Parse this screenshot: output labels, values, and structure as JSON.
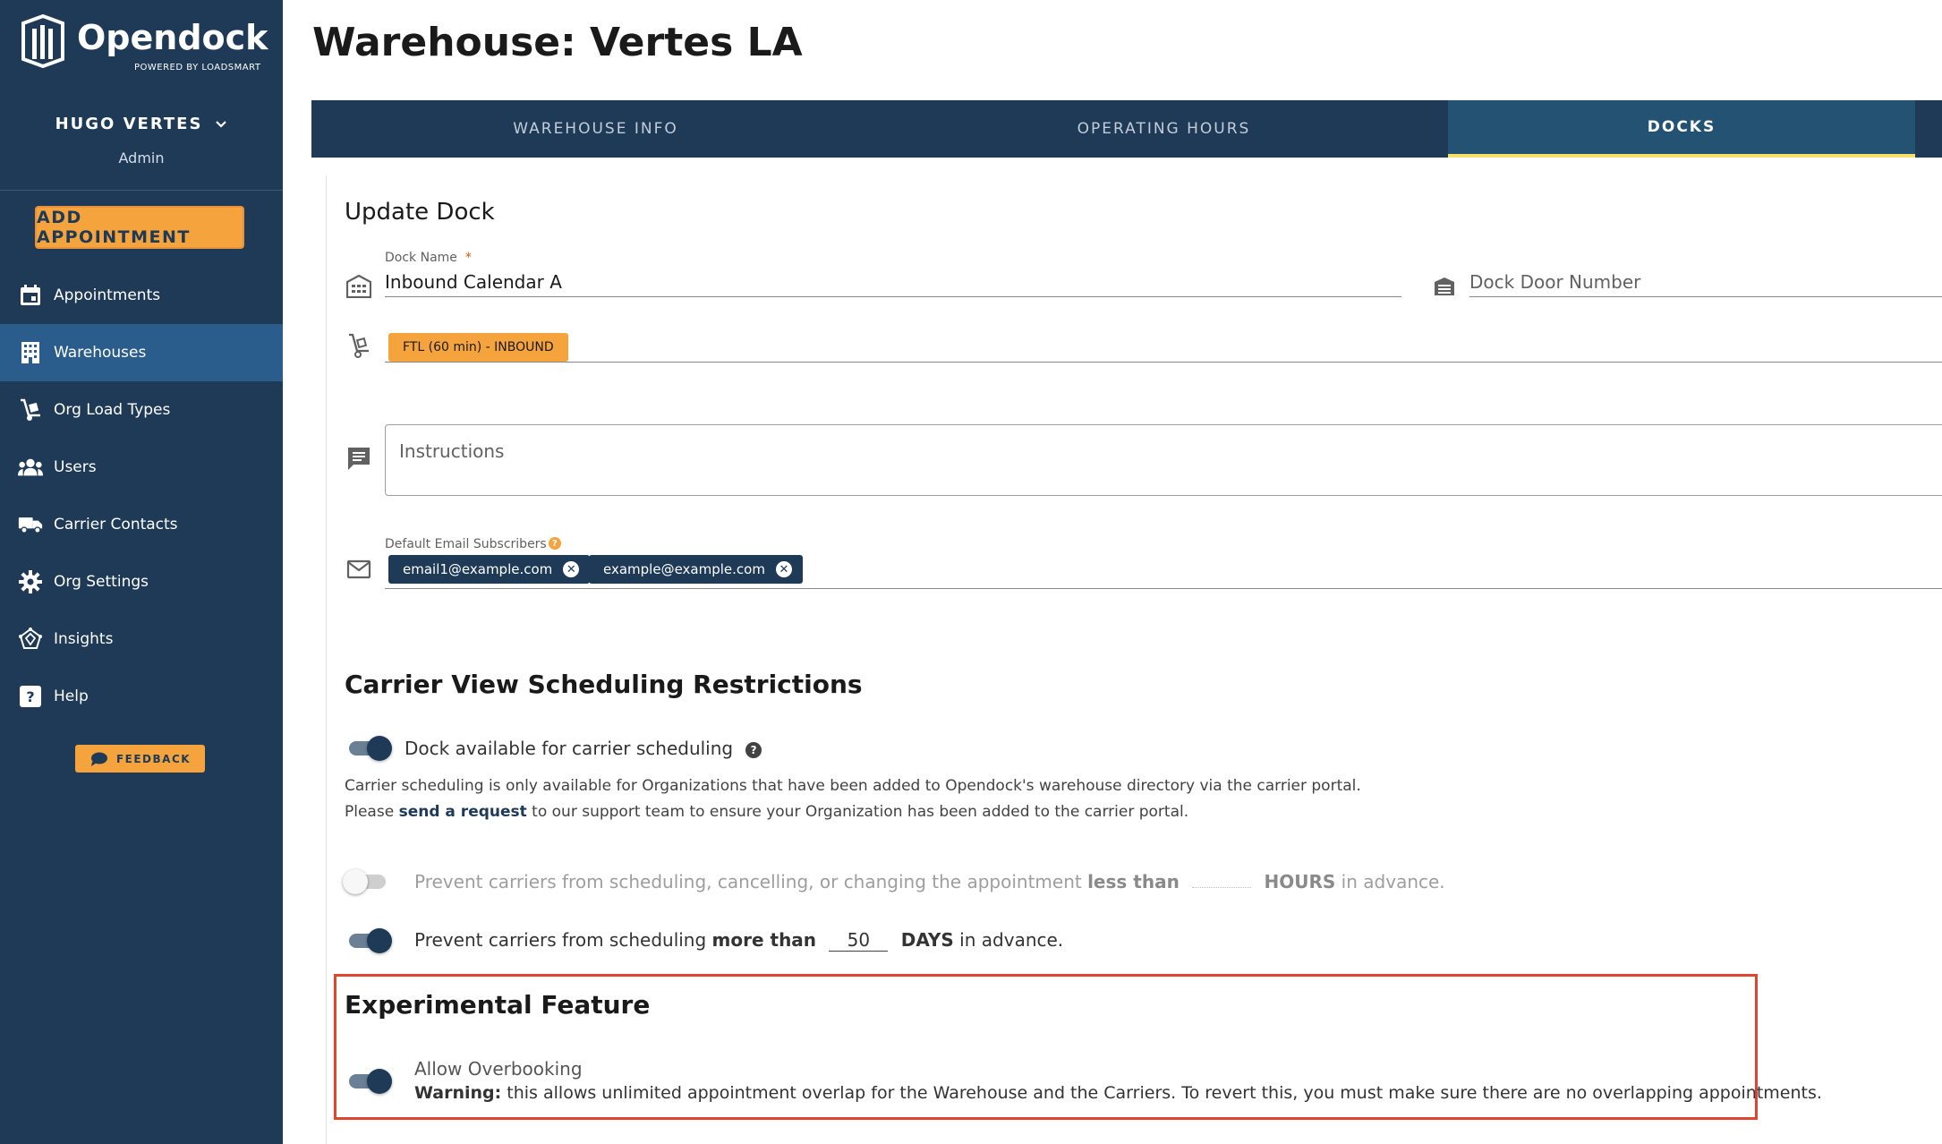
{
  "app": {
    "brand_name": "Opendock",
    "brand_sub": "POWERED BY LOADSMART",
    "user_name": "HUGO VERTES",
    "user_role": "Admin",
    "add_appointment": "ADD APPOINTMENT",
    "feedback": "FEEDBACK"
  },
  "nav": {
    "items": [
      {
        "label": "Appointments",
        "icon": "calendar-icon"
      },
      {
        "label": "Warehouses",
        "icon": "building-icon"
      },
      {
        "label": "Org Load Types",
        "icon": "hand-truck-icon"
      },
      {
        "label": "Users",
        "icon": "users-icon"
      },
      {
        "label": "Carrier Contacts",
        "icon": "truck-icon"
      },
      {
        "label": "Org Settings",
        "icon": "gear-icon"
      },
      {
        "label": "Insights",
        "icon": "insights-icon"
      },
      {
        "label": "Help",
        "icon": "help-icon"
      }
    ],
    "active": "Warehouses"
  },
  "page": {
    "title": "Warehouse: Vertes LA",
    "tabs": [
      {
        "label": "WAREHOUSE INFO"
      },
      {
        "label": "OPERATING HOURS"
      },
      {
        "label": "DOCKS"
      }
    ],
    "active_tab": "DOCKS"
  },
  "form": {
    "title": "Update Dock",
    "dock_name_label": "Dock Name",
    "dock_name_required": "*",
    "dock_name_value": "Inbound Calendar A",
    "dock_door_placeholder": "Dock Door Number",
    "load_type_chip": "FTL (60 min) - INBOUND",
    "instructions_label": "Instructions",
    "subscribers_label": "Default Email Subscribers",
    "subscribers": [
      "email1@example.com",
      "example@example.com"
    ]
  },
  "restrictions": {
    "title": "Carrier View Scheduling Restrictions",
    "dock_available_label": "Dock available for carrier scheduling",
    "dock_available_on": true,
    "desc_line1": "Carrier scheduling is only available for Organizations that have been added to Opendock's warehouse directory via the carrier portal.",
    "desc_line2_pre": "Please ",
    "desc_line2_link": "send a request",
    "desc_line2_post": " to our support team to ensure your Organization has been added to the carrier portal.",
    "prevent_less": {
      "pre": "Prevent carriers from scheduling, cancelling, or changing the appointment ",
      "bold": "less than",
      "value": "",
      "unit": "HOURS",
      "post": " in advance.",
      "on": false
    },
    "prevent_more": {
      "pre": "Prevent carriers from scheduling ",
      "bold": "more than",
      "value": "50",
      "unit": "DAYS",
      "post": " in advance.",
      "on": true
    }
  },
  "experimental": {
    "title": "Experimental Feature",
    "overbooking_label": "Allow Overbooking",
    "overbooking_on": true,
    "warning_bold": "Warning:",
    "warning_text": " this allows unlimited appointment overlap for the Warehouse and the Carriers. To revert this, you must make sure there are no overlapping appointments."
  },
  "colors": {
    "sidebar": "#1e3a57",
    "accent": "#f5a43d",
    "active_nav": "#2a5d8c",
    "highlight_box": "#e0462d"
  }
}
